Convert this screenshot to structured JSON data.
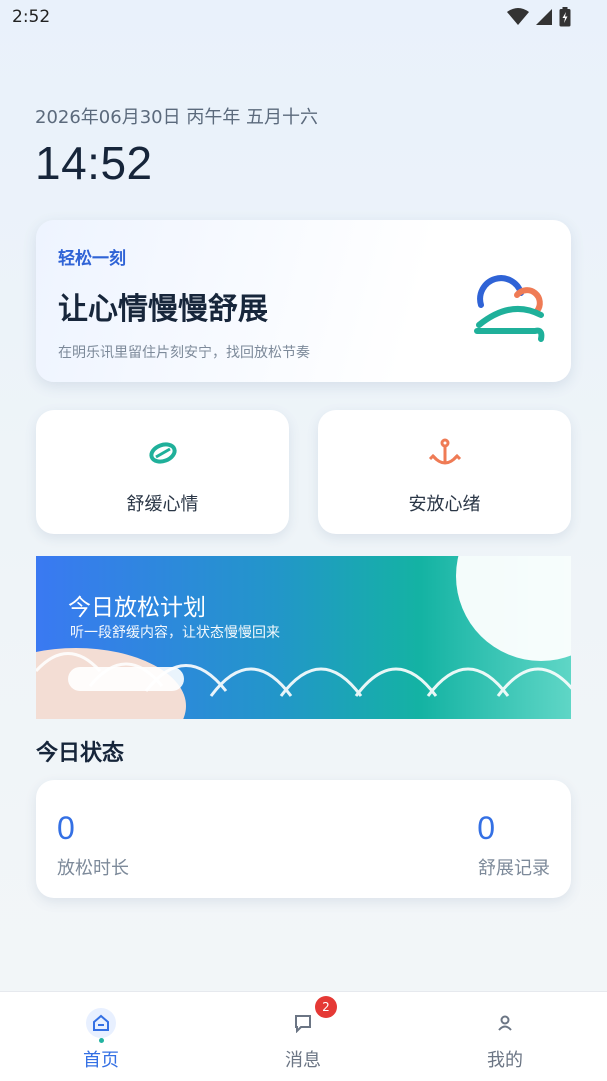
{
  "status_bar": {
    "time": "2:52",
    "icons": [
      "wifi-icon",
      "signal-icon",
      "battery-icon"
    ]
  },
  "header": {
    "date_line": "2026年06月30日 丙午年 五月十六",
    "clock": "14:52"
  },
  "hero_card": {
    "tag": "轻松一刻",
    "title": "让心情慢慢舒展",
    "subtitle": "在明乐讯里留住片刻安宁，找回放松节奏",
    "art_icon": "cloud-swirl-illustration"
  },
  "quick_actions": [
    {
      "label": "舒缓心情",
      "icon": "leaf-icon",
      "color": "#1fb09a"
    },
    {
      "label": "安放心绪",
      "icon": "anchor-icon",
      "color": "#ef7b55"
    }
  ],
  "plan_banner": {
    "title": "今日放松计划",
    "subtitle": "听一段舒缓内容，让状态慢慢回来"
  },
  "today_status": {
    "title": "今日状态",
    "stats": [
      {
        "value": "0",
        "label": "放松时长"
      },
      {
        "value": "0",
        "label": "舒展记录"
      }
    ]
  },
  "tab_bar": {
    "tabs": [
      {
        "label": "首页",
        "icon": "home-icon",
        "active": true
      },
      {
        "label": "消息",
        "icon": "message-icon",
        "badge": "2"
      },
      {
        "label": "我的",
        "icon": "user-icon"
      }
    ]
  },
  "colors": {
    "accent": "#3470e4",
    "teal": "#1fb09a",
    "coral": "#ef7b55",
    "badge": "#e53935"
  }
}
